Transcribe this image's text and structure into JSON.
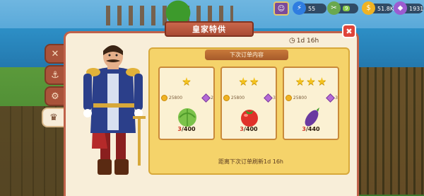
{
  "hud": {
    "energy": "55",
    "tool_value": "9",
    "coins": "51.8K",
    "gems": "1931"
  },
  "panel": {
    "title": "皇家特供",
    "timer": "1d 16h",
    "board_header": "下次订单内容",
    "next_order_text": "距离下次订单刷新1d 16h"
  },
  "cards": [
    {
      "stars": 1,
      "coin_reward": "25800",
      "gem_reward": "2",
      "item": "cabbage-icon",
      "qty_have": "3",
      "qty_need": "/400"
    },
    {
      "stars": 2,
      "coin_reward": "25800",
      "gem_reward": "3",
      "item": "tomato-icon",
      "qty_have": "3",
      "qty_need": "/400"
    },
    {
      "stars": 3,
      "coin_reward": "25800",
      "gem_reward": "3",
      "item": "eggplant-icon",
      "qty_have": "3",
      "qty_need": "/440"
    }
  ],
  "colors": {
    "panel_border": "#c0624a",
    "board_bg": "#f5d36a",
    "close_button": "#e0443a"
  }
}
